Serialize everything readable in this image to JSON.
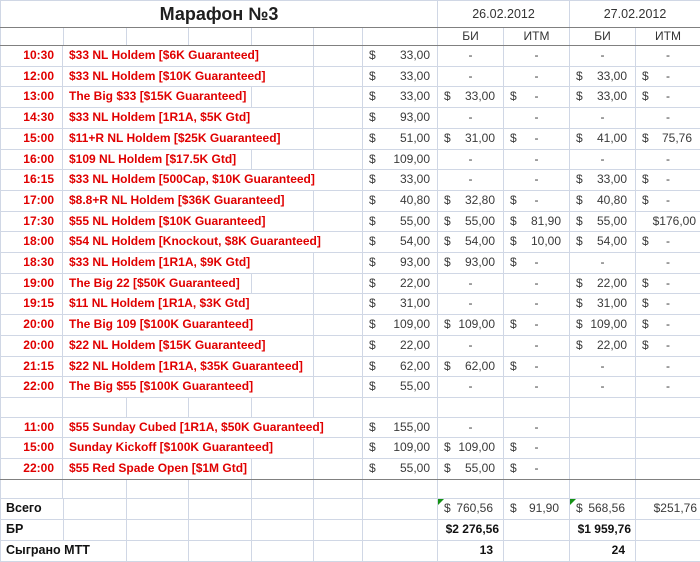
{
  "title": "Марафон №3",
  "dates": [
    "26.02.2012",
    "27.02.2012"
  ],
  "col_headers": [
    "БИ",
    "ИТМ",
    "БИ",
    "ИТМ"
  ],
  "colors": {
    "accent_red": "#e00000",
    "gridline": "#d0d7e5",
    "section_border": "#808080",
    "flag_green": "#149114"
  },
  "empty_row_before_index": 17,
  "tournaments": [
    {
      "time": "10:30",
      "name": "$33 NL Holdem [$6K Guaranteed]",
      "buyin": "33,00",
      "cells": [
        "-",
        "-",
        "-",
        "-"
      ]
    },
    {
      "time": "12:00",
      "name": "$33 NL Holdem [$10K Guaranteed]",
      "buyin": "33,00",
      "cells": [
        "-",
        "-",
        "$ 33,00",
        "$ -"
      ]
    },
    {
      "time": "13:00",
      "name": "The Big $33 [$15K Guaranteed]",
      "buyin": "33,00",
      "cells": [
        "$ 33,00",
        "$ -",
        "$ 33,00",
        "$ -"
      ]
    },
    {
      "time": "14:30",
      "name": "$33 NL Holdem [1R1A, $5K Gtd]",
      "buyin": "93,00",
      "cells": [
        "-",
        "-",
        "-",
        "-"
      ]
    },
    {
      "time": "15:00",
      "name": "$11+R NL Holdem [$25K Guaranteed]",
      "buyin": "51,00",
      "cells": [
        "$ 31,00",
        "$ -",
        "$ 41,00",
        "$ 75,76"
      ]
    },
    {
      "time": "16:00",
      "name": "$109 NL Holdem [$17.5K Gtd]",
      "buyin": "109,00",
      "cells": [
        "-",
        "-",
        "-",
        "-"
      ]
    },
    {
      "time": "16:15",
      "name": "$33 NL Holdem [500Cap, $10K Guaranteed]",
      "buyin": "33,00",
      "cells": [
        "-",
        "-",
        "$ 33,00",
        "$ -"
      ]
    },
    {
      "time": "17:00",
      "name": "$8.8+R NL Holdem [$36K Guaranteed]",
      "buyin": "40,80",
      "cells": [
        "$ 32,80",
        "$ -",
        "$ 40,80",
        "$ -"
      ]
    },
    {
      "time": "17:30",
      "name": "$55 NL Holdem [$10K Guaranteed]",
      "buyin": "55,00",
      "cells": [
        "$ 55,00",
        "$ 81,90",
        "$ 55,00",
        "$176,00"
      ]
    },
    {
      "time": "18:00",
      "name": "$54 NL Holdem [Knockout, $8K Guaranteed]",
      "buyin": "54,00",
      "cells": [
        "$ 54,00",
        "$ 10,00",
        "$ 54,00",
        "$ -"
      ]
    },
    {
      "time": "18:30",
      "name": "$33 NL Holdem [1R1A, $9K Gtd]",
      "buyin": "93,00",
      "cells": [
        "$ 93,00",
        "$ -",
        "-",
        "-"
      ]
    },
    {
      "time": "19:00",
      "name": "The Big 22 [$50K Guaranteed]",
      "buyin": "22,00",
      "cells": [
        "-",
        "-",
        "$ 22,00",
        "$ -"
      ]
    },
    {
      "time": "19:15",
      "name": "$11 NL Holdem [1R1A, $3K Gtd]",
      "buyin": "31,00",
      "cells": [
        "-",
        "-",
        "$ 31,00",
        "$ -"
      ]
    },
    {
      "time": "20:00",
      "name": "The Big 109 [$100K Guaranteed]",
      "buyin": "109,00",
      "cells": [
        "$ 109,00",
        "$ -",
        "$ 109,00",
        "$ -"
      ]
    },
    {
      "time": "20:00",
      "name": "$22 NL Holdem [$15K Guaranteed]",
      "buyin": "22,00",
      "cells": [
        "-",
        "-",
        "$ 22,00",
        "$ -"
      ]
    },
    {
      "time": "21:15",
      "name": "$22 NL Holdem [1R1A, $35K Guaranteed]",
      "buyin": "62,00",
      "cells": [
        "$ 62,00",
        "$ -",
        "-",
        "-"
      ]
    },
    {
      "time": "22:00",
      "name": "The Big $55 [$100K Guaranteed]",
      "buyin": "55,00",
      "cells": [
        "-",
        "-",
        "-",
        "-"
      ]
    },
    {
      "time": "11:00",
      "name": "$55 Sunday Cubed [1R1A, $50K Guaranteed]",
      "buyin": "155,00",
      "cells": [
        "-",
        "-",
        "",
        ""
      ]
    },
    {
      "time": "15:00",
      "name": "Sunday Kickoff [$100K Guaranteed]",
      "buyin": "109,00",
      "cells": [
        "$ 109,00",
        "$ -",
        "",
        ""
      ]
    },
    {
      "time": "22:00",
      "name": "$55 Red Spade Open [$1M Gtd]",
      "buyin": "55,00",
      "cells": [
        "$ 55,00",
        "$ -",
        "",
        ""
      ]
    }
  ],
  "summary": {
    "total": {
      "label": "Всего",
      "values": [
        "$ 760,56",
        "$ 91,90",
        "$ 568,56",
        "$251,76"
      ],
      "flags": [
        true,
        false,
        true,
        false
      ]
    },
    "bankroll": {
      "label": "БР",
      "values": [
        "$2 276,56",
        "",
        "$1 959,76",
        ""
      ]
    },
    "played": {
      "label": "Сыграно МТТ",
      "values": [
        "13",
        "",
        "24",
        ""
      ]
    }
  }
}
